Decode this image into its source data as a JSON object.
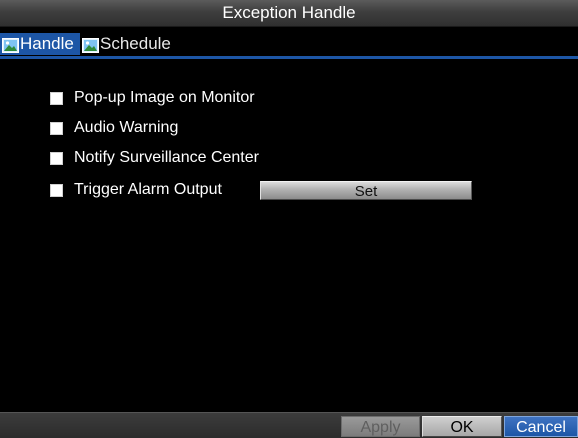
{
  "window": {
    "title": "Exception Handle"
  },
  "tabs": [
    {
      "label": "Handle",
      "icon": "picture-icon",
      "active": true
    },
    {
      "label": "Schedule",
      "icon": "picture-icon",
      "active": false
    }
  ],
  "options": [
    {
      "label": "Pop-up Image on Monitor",
      "checked": false
    },
    {
      "label": "Audio Warning",
      "checked": false
    },
    {
      "label": "Notify Surveillance Center",
      "checked": false
    },
    {
      "label": "Trigger Alarm Output",
      "checked": false
    }
  ],
  "set_button": {
    "label": "Set"
  },
  "footer": {
    "apply_label": "Apply",
    "apply_enabled": false,
    "ok_label": "OK",
    "cancel_label": "Cancel"
  },
  "colors": {
    "accent": "#1d56a6",
    "background": "#000000",
    "text": "#ffffff"
  }
}
